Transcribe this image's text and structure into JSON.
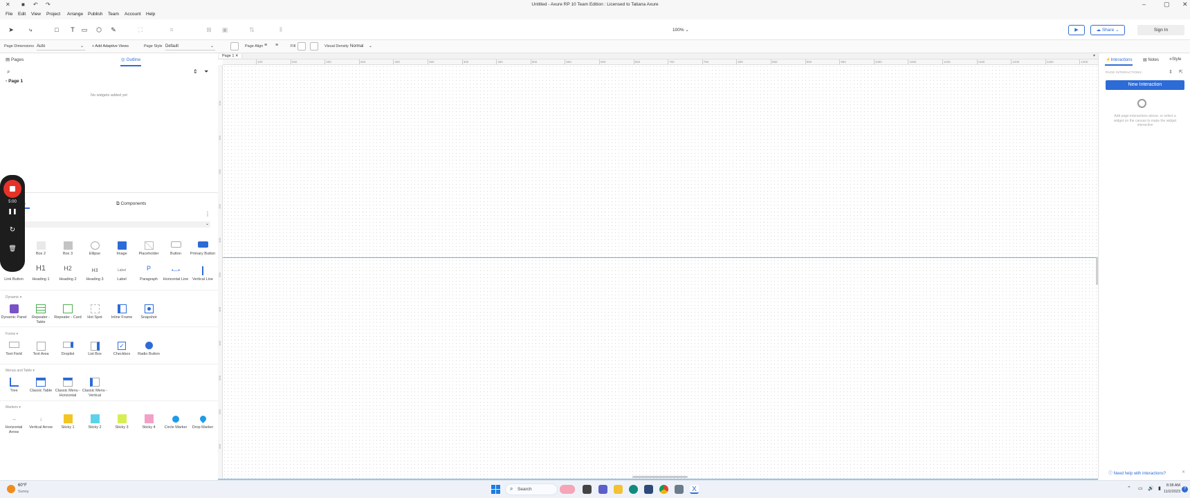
{
  "window": {
    "title": "Untitled - Axure RP 10 Team Edition : Licensed to Tatiana Axure"
  },
  "menu": [
    "File",
    "Edit",
    "View",
    "Project",
    "Arrange",
    "Publish",
    "Team",
    "Account",
    "Help"
  ],
  "toolbar": {
    "zoom": "100%",
    "share_label": "Share",
    "signin_label": "Sign In"
  },
  "options_bar": {
    "page_dimensions_label": "Page Dimensions",
    "page_dimensions_value": "Auto",
    "add_adaptive_views": "+ Add Adaptive Views",
    "page_style_label": "Page Style",
    "page_style_value": "Default",
    "page_align_label": "Page Align",
    "fill_label": "Fill",
    "visual_density_label": "Visual Density",
    "visual_density_value": "Normal"
  },
  "left_panel": {
    "tabs": [
      "Pages",
      "Outline"
    ],
    "pages": [
      "Page 1"
    ],
    "empty_message": "No widgets added yet",
    "library_tab_fragment": "s",
    "components_tab": "Components",
    "library_rows": [
      [
        "Box 2",
        "Box 3",
        "Ellipse",
        "Image",
        "Placeholder",
        "Button",
        "Primary Button"
      ],
      [
        "Link Button",
        "Heading 1",
        "Heading 2",
        "Heading 3",
        "Label",
        "Paragraph",
        "Horizontal Line",
        "Vertical Line"
      ]
    ],
    "heading_glyphs": [
      "H1",
      "H2",
      "H3"
    ],
    "label_glyph": "Label",
    "paragraph_glyph": "P",
    "sections": [
      {
        "name": "Dynamic",
        "items": [
          "Dynamic Panel",
          "Repeater - Table",
          "Repeater - Card",
          "Hot Spot",
          "Inline Frame",
          "Snapshot"
        ]
      },
      {
        "name": "Forms",
        "items": [
          "Text Field",
          "Text Area",
          "Droplist",
          "List Box",
          "Checkbox",
          "Radio Button"
        ]
      },
      {
        "name": "Menus and Table",
        "items": [
          "Tree",
          "Classic Table",
          "Classic Menu - Horizontal",
          "Classic Menu - Vertical"
        ]
      },
      {
        "name": "Markers",
        "items": [
          "Horizontal Arrow",
          "Vertical Arrow",
          "Sticky 1",
          "Sticky 2",
          "Sticky 3",
          "Sticky 4",
          "Circle Marker",
          "Drop Marker"
        ]
      }
    ]
  },
  "recorder": {
    "time": "5:00"
  },
  "canvas": {
    "tab": "Page 1",
    "ruler_h": [
      "100",
      "150",
      "200",
      "250",
      "300",
      "350",
      "400",
      "450",
      "500",
      "550",
      "600",
      "650",
      "700",
      "750",
      "800",
      "850",
      "900",
      "950",
      "1000",
      "1050",
      "1100",
      "1150",
      "1200",
      "1250",
      "1300"
    ],
    "ruler_v": [
      "100",
      "150",
      "200",
      "250",
      "300",
      "350",
      "400",
      "450",
      "500",
      "550",
      "600",
      "650"
    ]
  },
  "right_panel": {
    "tabs": [
      "Interactions",
      "Notes",
      "Style"
    ],
    "section_label": "PAGE INTERACTIONS",
    "new_interaction": "New Interaction",
    "hint": "Add page interactions above, or select a widget on the canvas to make the widget interactive",
    "help_link": "Need help with interactions?"
  },
  "taskbar": {
    "weather_temp": "60°F",
    "weather_desc": "Sunny",
    "search_label": "Search",
    "time": "8:38 AM",
    "date": "11/2/2023"
  },
  "colors": {
    "accent": "#2d6bd6",
    "guide": "#43c7d6",
    "recorder_red": "#e5332a"
  }
}
